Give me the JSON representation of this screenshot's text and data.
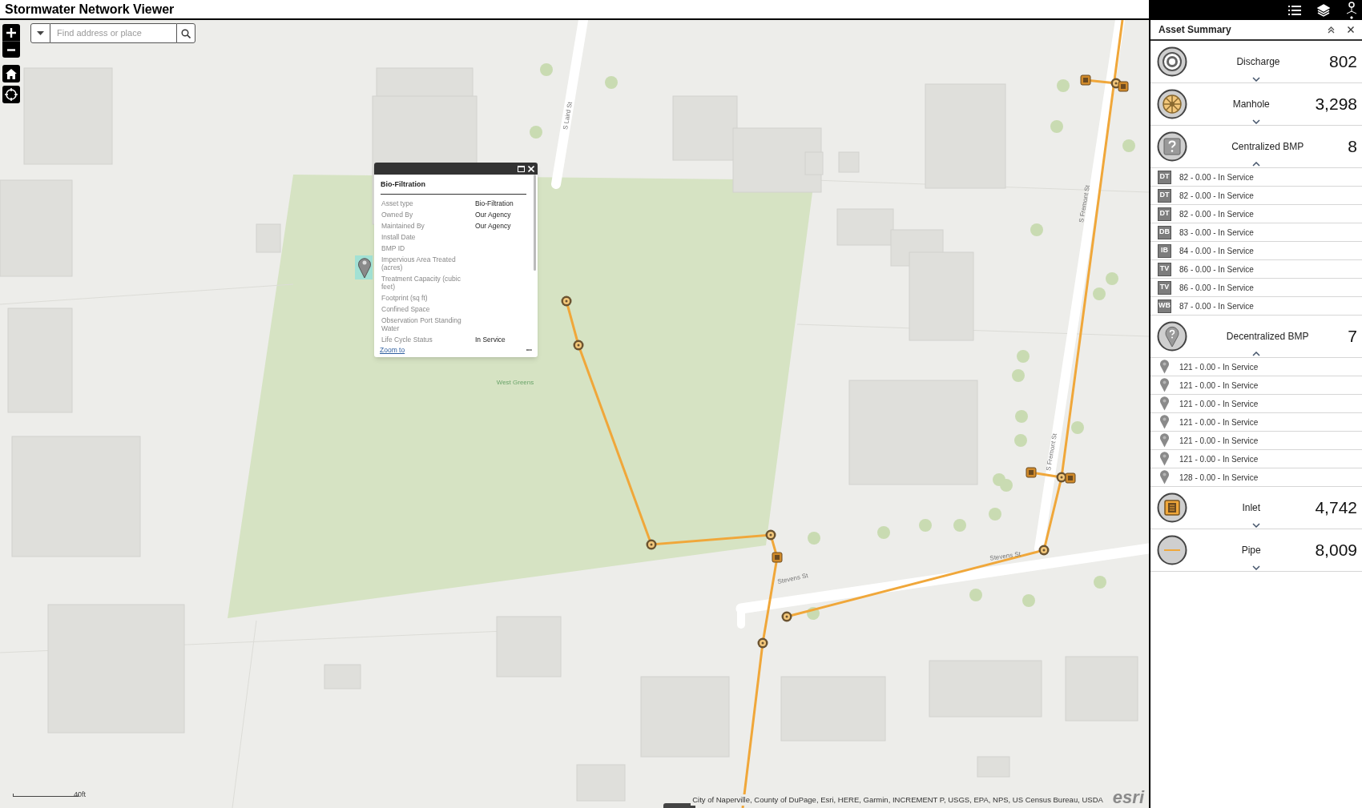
{
  "app": {
    "title": "Stormwater Network Viewer"
  },
  "search": {
    "placeholder": "Find address or place"
  },
  "popup": {
    "title": "Bio-Filtration",
    "fields": [
      {
        "label": "Asset type",
        "value": "Bio-Filtration"
      },
      {
        "label": "Owned By",
        "value": "Our Agency"
      },
      {
        "label": "Maintained By",
        "value": "Our Agency"
      },
      {
        "label": "Install Date"
      },
      {
        "label": "BMP ID"
      },
      {
        "label": "Impervious Area Treated (acres)"
      },
      {
        "label": "Treatment Capacity (cubic feet)"
      },
      {
        "label": "Footprint (sq ft)"
      },
      {
        "label": "Confined Space"
      },
      {
        "label": "Observation Port Standing Water"
      },
      {
        "label": "Life Cycle Status",
        "value": "In Service"
      }
    ],
    "link": "Zoom to",
    "more": "•••"
  },
  "map": {
    "labels": [
      "S Laird St",
      "S Fremont St",
      "S Fremont St",
      "Stevens St",
      "Stevens St",
      "West Greens"
    ],
    "scale": "40ft",
    "attribution": "City of Naperville, County of DuPage, Esri, HERE, Garmin, INCREMENT P, USGS, EPA, NPS, US Census Bureau, USDA",
    "logo": "esri"
  },
  "panel": {
    "title": "Asset Summary",
    "categories": [
      {
        "kind": "discharge",
        "name": "Discharge",
        "count": "802",
        "expanded": false
      },
      {
        "kind": "manhole",
        "name": "Manhole",
        "count": "3,298",
        "expanded": false
      },
      {
        "kind": "centralized",
        "name": "Centralized BMP",
        "count": "8",
        "expanded": true,
        "items": [
          {
            "kind": "badge",
            "badge": "DT",
            "text": "82 - 0.00 - In Service"
          },
          {
            "kind": "badge",
            "badge": "DT",
            "text": "82 - 0.00 - In Service"
          },
          {
            "kind": "badge",
            "badge": "DT",
            "text": "82 - 0.00 - In Service"
          },
          {
            "kind": "badge",
            "badge": "DB",
            "text": "83 - 0.00 - In Service"
          },
          {
            "kind": "badge",
            "badge": "IB",
            "text": "84 - 0.00 - In Service"
          },
          {
            "kind": "badge",
            "badge": "TV",
            "text": "86 - 0.00 - In Service"
          },
          {
            "kind": "badge",
            "badge": "TV",
            "text": "86 - 0.00 - In Service"
          },
          {
            "kind": "badge",
            "badge": "WB",
            "text": "87 - 0.00 - In Service"
          }
        ]
      },
      {
        "kind": "decentralized",
        "name": "Decentralized BMP",
        "count": "7",
        "expanded": true,
        "items": [
          {
            "kind": "pin",
            "text": "121 - 0.00 - In Service"
          },
          {
            "kind": "pin",
            "text": "121 - 0.00 - In Service"
          },
          {
            "kind": "pin",
            "text": "121 - 0.00 - In Service"
          },
          {
            "kind": "pin",
            "text": "121 - 0.00 - In Service"
          },
          {
            "kind": "pin",
            "text": "121 - 0.00 - In Service"
          },
          {
            "kind": "pin",
            "text": "121 - 0.00 - In Service"
          },
          {
            "kind": "pin",
            "text": "128 - 0.00 - In Service"
          }
        ]
      },
      {
        "kind": "inlet",
        "name": "Inlet",
        "count": "4,742",
        "expanded": false
      },
      {
        "kind": "pipe",
        "name": "Pipe",
        "count": "8,009",
        "expanded": false
      }
    ]
  }
}
